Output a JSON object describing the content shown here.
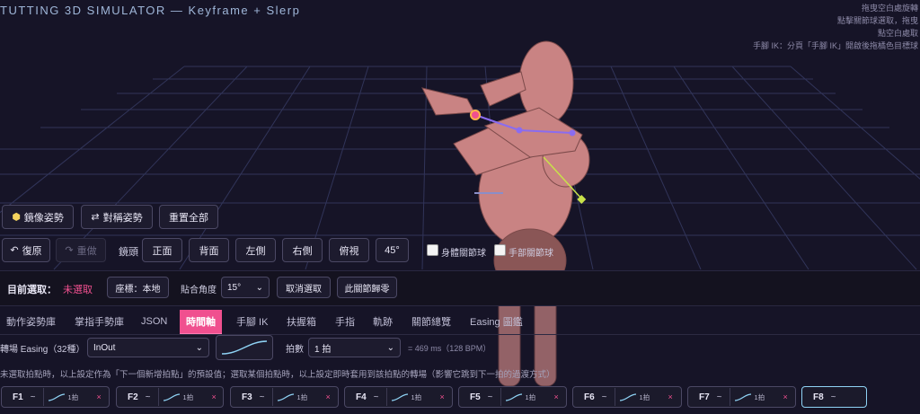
{
  "app": {
    "title": "TUTTING 3D SIMULATOR — Keyframe + Slerp"
  },
  "hints": [
    "拖曳空白處旋轉",
    "點擊關節球選取，拖曳",
    "點空白處取",
    "手腳 IK：分頁「手腳 IK」開啟後拖橘色目標球"
  ],
  "toolbar": {
    "mirror_label": "鏡像姿勢",
    "symmetric_label": "對稱姿勢",
    "reset_all_label": "重置全部",
    "undo_label": "復原",
    "redo_label": "重做",
    "camera_label": "鏡頭",
    "views": [
      "正面",
      "背面",
      "左側",
      "右側",
      "俯視",
      "45°"
    ],
    "body_joints_label": "身體關節球",
    "hand_joints_label": "手部關節球"
  },
  "selection": {
    "label": "目前選取：",
    "value": "未選取",
    "coord_label": "座標：本地",
    "snap_label": "貼合角度",
    "snap_value": "15°",
    "deselect_label": "取消選取",
    "zero_label": "此關節歸零"
  },
  "tabs": [
    {
      "label": "動作姿勢庫",
      "active": false
    },
    {
      "label": "掌指手勢庫",
      "active": false
    },
    {
      "label": "JSON",
      "active": false
    },
    {
      "label": "時間軸",
      "active": true
    },
    {
      "label": "手腳 IK",
      "active": false
    },
    {
      "label": "扶握箱",
      "active": false
    },
    {
      "label": "手指",
      "active": false
    },
    {
      "label": "軌跡",
      "active": false
    },
    {
      "label": "關節總覽",
      "active": false
    },
    {
      "label": "Easing 圖鑑",
      "active": false
    }
  ],
  "timeline": {
    "easing_label": "轉場 Easing（32種）",
    "easing_value": "InOut",
    "beats_label": "拍數",
    "beats_value": "1 拍",
    "duration_text": "= 469 ms（128 BPM）",
    "note": "未選取拍點時，以上設定作為「下一個新增拍點」的預設值；選取某個拍點時，以上設定即時套用到該拍點的轉場（影響它跳到下一拍的過渡方式）",
    "keyframes": [
      {
        "name": "F1",
        "tilde": "~",
        "beat": "1拍",
        "close": "×"
      },
      {
        "name": "F2",
        "tilde": "~",
        "beat": "1拍",
        "close": "×"
      },
      {
        "name": "F3",
        "tilde": "~",
        "beat": "1拍",
        "close": "×"
      },
      {
        "name": "F4",
        "tilde": "~",
        "beat": "1拍",
        "close": "×"
      },
      {
        "name": "F5",
        "tilde": "~",
        "beat": "1拍",
        "close": "×"
      },
      {
        "name": "F6",
        "tilde": "~",
        "beat": "1拍",
        "close": "×"
      },
      {
        "name": "F7",
        "tilde": "~",
        "beat": "1拍",
        "close": "×"
      },
      {
        "name": "F8",
        "tilde": "~"
      }
    ]
  },
  "colors": {
    "accent": "#f0508f",
    "grid": "#3a3f6a",
    "figure": "#c98383",
    "ik_line": "#8a6cf0",
    "ik_target": "#c8e14a"
  }
}
